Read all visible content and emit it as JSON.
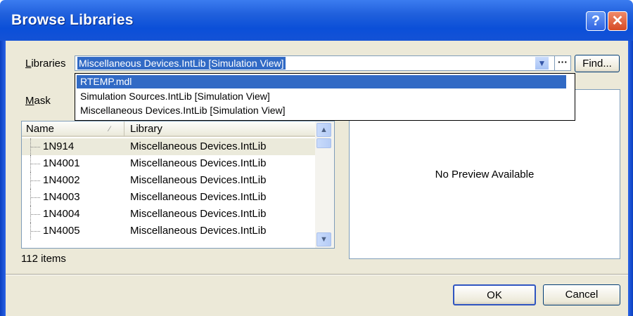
{
  "window": {
    "title": "Browse Libraries",
    "help_glyph": "?",
    "close_glyph": "✕"
  },
  "libraries": {
    "label": "Libraries",
    "selected": "Miscellaneous Devices.IntLib [Simulation View]",
    "dots_label": "···",
    "find_label": "Find...",
    "options": [
      "RTEMP.mdl",
      "Simulation Sources.IntLib [Simulation View]",
      "Miscellaneous Devices.IntLib [Simulation View]"
    ]
  },
  "mask": {
    "label": "Mask"
  },
  "list": {
    "columns": [
      "Name",
      "Library"
    ],
    "rows": [
      {
        "name": "1N914",
        "library": "Miscellaneous Devices.IntLib"
      },
      {
        "name": "1N4001",
        "library": "Miscellaneous Devices.IntLib"
      },
      {
        "name": "1N4002",
        "library": "Miscellaneous Devices.IntLib"
      },
      {
        "name": "1N4003",
        "library": "Miscellaneous Devices.IntLib"
      },
      {
        "name": "1N4004",
        "library": "Miscellaneous Devices.IntLib"
      },
      {
        "name": "1N4005",
        "library": "Miscellaneous Devices.IntLib"
      }
    ],
    "count_text": "112 items"
  },
  "preview": {
    "text": "No Preview Available"
  },
  "buttons": {
    "ok": "OK",
    "cancel": "Cancel"
  }
}
